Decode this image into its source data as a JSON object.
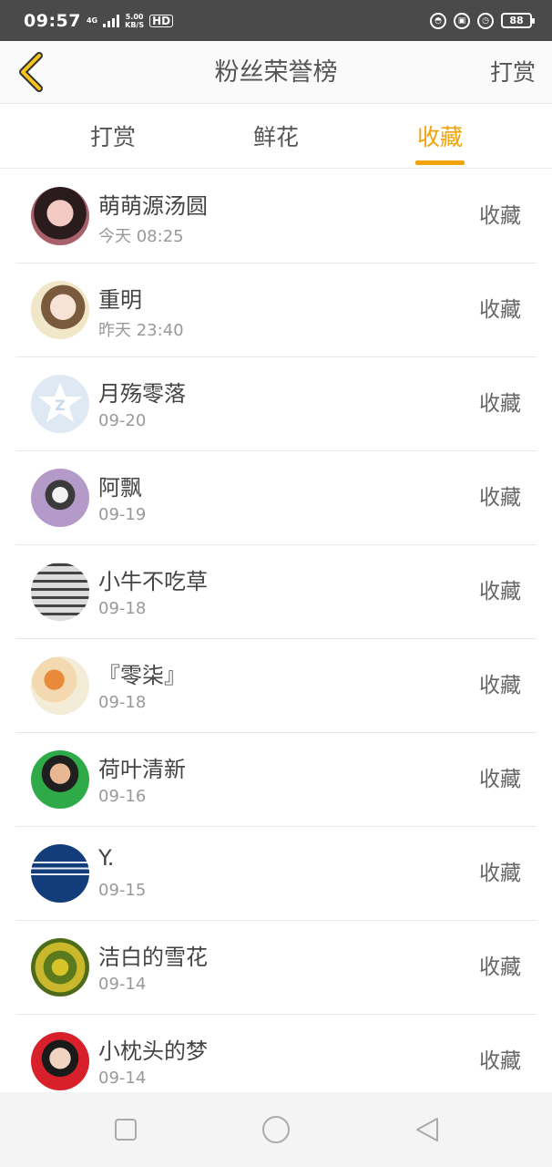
{
  "status_bar": {
    "time": "09:57",
    "network": "4G",
    "speed_value": "5.00",
    "speed_unit": "KB/S",
    "hd": "HD",
    "battery": "88"
  },
  "header": {
    "title": "粉丝荣誉榜",
    "action_label": "打赏"
  },
  "tabs": [
    {
      "label": "打赏",
      "active": false
    },
    {
      "label": "鲜花",
      "active": false
    },
    {
      "label": "收藏",
      "active": true
    }
  ],
  "accent_color": "#f0a30a",
  "list": [
    {
      "name": "萌萌源汤圆",
      "time": "今天 08:25",
      "action": "收藏"
    },
    {
      "name": "重明",
      "time": "昨天 23:40",
      "action": "收藏"
    },
    {
      "name": "月殇零落",
      "time": "09-20",
      "action": "收藏"
    },
    {
      "name": "阿飘",
      "time": "09-19",
      "action": "收藏"
    },
    {
      "name": "小牛不吃草",
      "time": "09-18",
      "action": "收藏"
    },
    {
      "name": "『零柒』",
      "time": "09-18",
      "action": "收藏"
    },
    {
      "name": "荷叶清新",
      "time": "09-16",
      "action": "收藏"
    },
    {
      "name": "Y.",
      "time": "09-15",
      "action": "收藏"
    },
    {
      "name": "洁白的雪花",
      "time": "09-14",
      "action": "收藏"
    },
    {
      "name": "小枕头的梦",
      "time": "09-14",
      "action": "收藏"
    }
  ],
  "icons": {
    "back": "chevron-left-icon",
    "nav_square": "recent-apps-icon",
    "nav_circle": "home-icon",
    "nav_triangle": "back-nav-icon"
  }
}
